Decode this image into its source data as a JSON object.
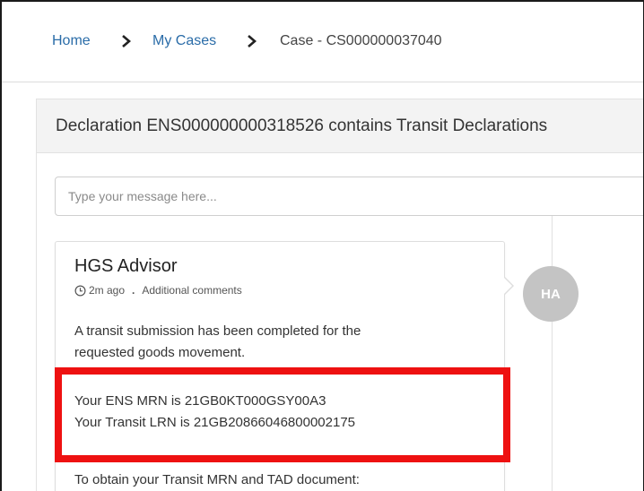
{
  "breadcrumb": {
    "home": "Home",
    "my_cases": "My Cases",
    "current": "Case - CS000000037040"
  },
  "panel": {
    "title": "Declaration ENS000000000318526 contains Transit Declarations"
  },
  "message_input": {
    "placeholder": "Type your message here..."
  },
  "comment": {
    "author": "HGS Advisor",
    "time": "2m ago",
    "separator": ".",
    "type": "Additional comments",
    "paragraph1_line1": "A transit submission has been completed for the",
    "paragraph1_line2": "requested goods movement.",
    "ens_line": "Your ENS MRN is 21GB0KT000GSY00A3",
    "lrn_line": "Your Transit LRN is 21GB20866046800002175",
    "paragraph3": "To obtain your Transit MRN and TAD document:"
  },
  "avatar": {
    "initials": "HA",
    "color": "#c4c4c4"
  },
  "colors": {
    "link": "#2a6ca8",
    "highlight": "#ee1111",
    "header_bg": "#f3f3f3"
  },
  "icons": [
    "chevron-right-icon",
    "clock-icon"
  ]
}
